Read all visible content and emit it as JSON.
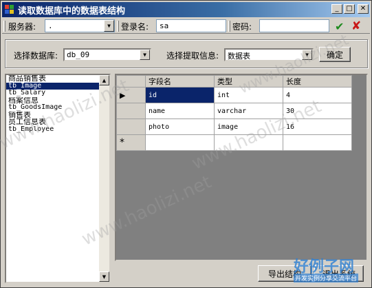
{
  "window": {
    "title": "读取数据库中的数据表结构"
  },
  "toolbar": {
    "server_label": "服务器:",
    "server_value": ".",
    "login_label": "登录名:",
    "login_value": "sa",
    "password_label": "密码:",
    "password_value": ""
  },
  "options": {
    "db_label": "选择数据库:",
    "db_value": "db_09",
    "extract_label": "选择提取信息:",
    "extract_value": "数据表",
    "confirm_label": "确定"
  },
  "tables": [
    {
      "name": "商品销售表",
      "mono": false
    },
    {
      "name": "tb_Image",
      "mono": true,
      "selected": true
    },
    {
      "name": "tb_Salary",
      "mono": true
    },
    {
      "name": "档案信息",
      "mono": false
    },
    {
      "name": "tb_GoodsImage",
      "mono": true
    },
    {
      "name": "销售表",
      "mono": false
    },
    {
      "name": "员工信息表",
      "mono": false
    },
    {
      "name": "tb_Employee",
      "mono": true
    }
  ],
  "grid": {
    "columns": [
      "字段名",
      "类型",
      "长度"
    ],
    "rows": [
      [
        "id",
        "int",
        "4"
      ],
      [
        "name",
        "varchar",
        "30"
      ],
      [
        "photo",
        "image",
        "16"
      ]
    ],
    "new_row_marker": "*"
  },
  "footer": {
    "export_label": "导出结构",
    "exit_label": "退出系统"
  },
  "watermark": {
    "text": "www.haolizi.net",
    "logo": "好例子网",
    "logo_sub": "开发实例分享交流平台"
  }
}
